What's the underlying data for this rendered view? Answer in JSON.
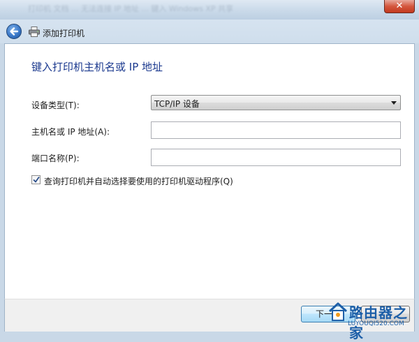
{
  "window": {
    "background_title_text": "打印机  文档 ... 无法连接 IP 地址 ... 键入 Windows XP 共享",
    "close_label": "✕"
  },
  "nav": {
    "title": "添加打印机"
  },
  "form": {
    "heading": "键入打印机主机名或 IP 地址",
    "device_type_label": "设备类型(T):",
    "device_type_value": "TCP/IP 设备",
    "hostname_label": "主机名或 IP 地址(A):",
    "hostname_value": "",
    "port_label": "端口名称(P):",
    "port_value": "",
    "query_checkbox_label": "查询打印机并自动选择要使用的打印机驱动程序(Q)",
    "query_checkbox_checked": true
  },
  "footer": {
    "next_label": "下一步"
  },
  "watermark": {
    "brand": "路由器之家",
    "url": "LUYOUQI520.COM"
  },
  "colors": {
    "heading": "#1c3a8f",
    "glass": "#c9d8e7",
    "close": "#c2391f",
    "watermark": "#1d5fa8"
  }
}
